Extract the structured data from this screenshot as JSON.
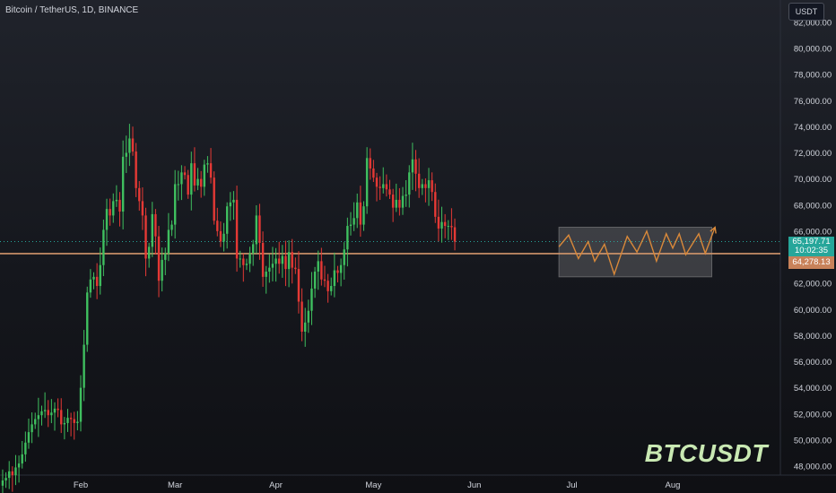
{
  "header": {
    "symbol_title": "Bitcoin / TetherUS, 1D, BINANCE",
    "currency_button": "USDT"
  },
  "watermark": "BTCUSDT",
  "price_tags": {
    "last_price": "65,197.71",
    "countdown": "10:02:35",
    "level_price": "64,278.13"
  },
  "colors": {
    "up": "#26a69a",
    "down": "#ef5350",
    "up_candle": "#3fbf5f",
    "down_candle": "#e53935",
    "level_line": "#d2956b",
    "projection": "#d9893a",
    "box": "#c8c8c8"
  },
  "chart_data": {
    "type": "candlestick",
    "title": "Bitcoin / TetherUS, 1D, BINANCE",
    "xlabel": "",
    "ylabel": "",
    "ylim": [
      47000,
      83000
    ],
    "grid": false,
    "x_ticks": [
      {
        "label": "Feb",
        "day": 31
      },
      {
        "label": "Mar",
        "day": 60
      },
      {
        "label": "Apr",
        "day": 91
      },
      {
        "label": "May",
        "day": 121
      },
      {
        "label": "Jun",
        "day": 152
      },
      {
        "label": "Jul",
        "day": 182
      },
      {
        "label": "Aug",
        "day": 213
      }
    ],
    "y_ticks": [
      "48,000.00",
      "50,000.00",
      "52,000.00",
      "54,000.00",
      "56,000.00",
      "58,000.00",
      "60,000.00",
      "62,000.00",
      "64,000.00",
      "66,000.00",
      "68,000.00",
      "70,000.00",
      "72,000.00",
      "74,000.00",
      "76,000.00",
      "78,000.00",
      "80,000.00",
      "82,000.00"
    ],
    "y_tick_values": [
      48000,
      50000,
      52000,
      54000,
      56000,
      58000,
      60000,
      62000,
      64000,
      66000,
      68000,
      70000,
      72000,
      74000,
      76000,
      78000,
      80000,
      82000
    ],
    "closes": [
      46900,
      47100,
      47600,
      47300,
      47900,
      48200,
      48900,
      49800,
      50600,
      51200,
      51600,
      51900,
      52200,
      52300,
      51900,
      52100,
      52400,
      52300,
      51200,
      51300,
      51700,
      51600,
      51300,
      51400,
      54000,
      57300,
      61300,
      62300,
      62500,
      61800,
      63400,
      66100,
      67700,
      67200,
      68300,
      68400,
      67500,
      71700,
      72000,
      73100,
      72100,
      69300,
      68300,
      67200,
      63900,
      64800,
      67300,
      65600,
      62200,
      63800,
      64300,
      66100,
      66500,
      69600,
      69600,
      70500,
      70300,
      68800,
      71200,
      69500,
      70000,
      69400,
      71100,
      71200,
      70100,
      66800,
      66000,
      65200,
      65800,
      67900,
      68200,
      68400,
      63900,
      63900,
      63400,
      63500,
      64300,
      65000,
      67200,
      65100,
      62500,
      62900,
      63200,
      63500,
      63900,
      63500,
      64100,
      63100,
      64400,
      63200,
      63100,
      60600,
      58300,
      59000,
      59900,
      61600,
      62900,
      63700,
      62300,
      62200,
      61400,
      61800,
      63000,
      62800,
      63400,
      64600,
      66400,
      66500,
      67000,
      68200,
      66500,
      67900,
      71600,
      70800,
      70100,
      69400,
      69300,
      69600,
      69200,
      68800,
      67800,
      68400,
      67800,
      68700,
      68800,
      70500,
      71500,
      70400,
      69300,
      69600,
      69300,
      69900,
      69000,
      67100,
      66200,
      66700,
      66400,
      66400,
      66300,
      65200
    ],
    "level": 64278.13,
    "last_price": 65197.71,
    "projection_box": {
      "x_from": 178,
      "x_to": 225,
      "y_from": 62500,
      "y_to": 66300
    },
    "projection_path": [
      {
        "day": 178,
        "price": 64800
      },
      {
        "day": 181,
        "price": 65700
      },
      {
        "day": 184,
        "price": 63900
      },
      {
        "day": 187,
        "price": 65200
      },
      {
        "day": 189,
        "price": 63700
      },
      {
        "day": 192,
        "price": 65000
      },
      {
        "day": 195,
        "price": 62700
      },
      {
        "day": 199,
        "price": 65600
      },
      {
        "day": 202,
        "price": 64400
      },
      {
        "day": 205,
        "price": 66000
      },
      {
        "day": 208,
        "price": 63700
      },
      {
        "day": 211,
        "price": 65800
      },
      {
        "day": 213,
        "price": 64700
      },
      {
        "day": 215,
        "price": 65800
      },
      {
        "day": 217,
        "price": 64200
      },
      {
        "day": 221,
        "price": 65800
      },
      {
        "day": 223,
        "price": 64300
      },
      {
        "day": 226,
        "price": 66300
      }
    ]
  }
}
